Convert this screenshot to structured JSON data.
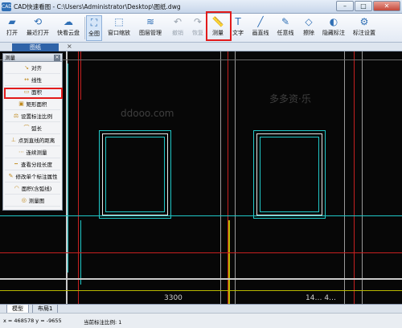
{
  "titlebar": {
    "app_badge": "CAD",
    "title": "CAD快速看图 - C:\\Users\\Administrator\\Desktop\\图纸.dwg",
    "minimize": "–",
    "maximize": "□",
    "close": "✕"
  },
  "toolbar": {
    "open": "打开",
    "recent": "最近打开",
    "cloud": "快看云盘",
    "full": "全图",
    "zoom": "窗口缩放",
    "layers": "图层管理",
    "undo": "撤销",
    "redo": "恢复",
    "measure": "测量",
    "text": "文字",
    "draw_line": "画直线",
    "any_line": "任意线",
    "erase": "擦除",
    "hide_mark": "隐藏标注",
    "mark_settings": "标注设置"
  },
  "tabs": {
    "doc_tab": "图纸",
    "close_glyph": "×"
  },
  "panel": {
    "title": "测量",
    "items": [
      "对齐",
      "线性",
      "面积",
      "矩形面积",
      "设置标注比例",
      "弧长",
      "点到直线的距离",
      "连续测量",
      "查看分段长度",
      "修改单个标注属性",
      "面积(含弧线)",
      "测量图"
    ]
  },
  "bottom_tabs": [
    "模型",
    "布局1"
  ],
  "status": {
    "coords": "x = 468578  y = -9655",
    "scale": "当前标注比例: 1"
  },
  "canvas_text": {
    "dim1": "3300",
    "dim2": "14…  4…"
  },
  "colors": {
    "highlight": "#e21b1b",
    "accent": "#2f63a8",
    "cad_bg": "#070707"
  }
}
